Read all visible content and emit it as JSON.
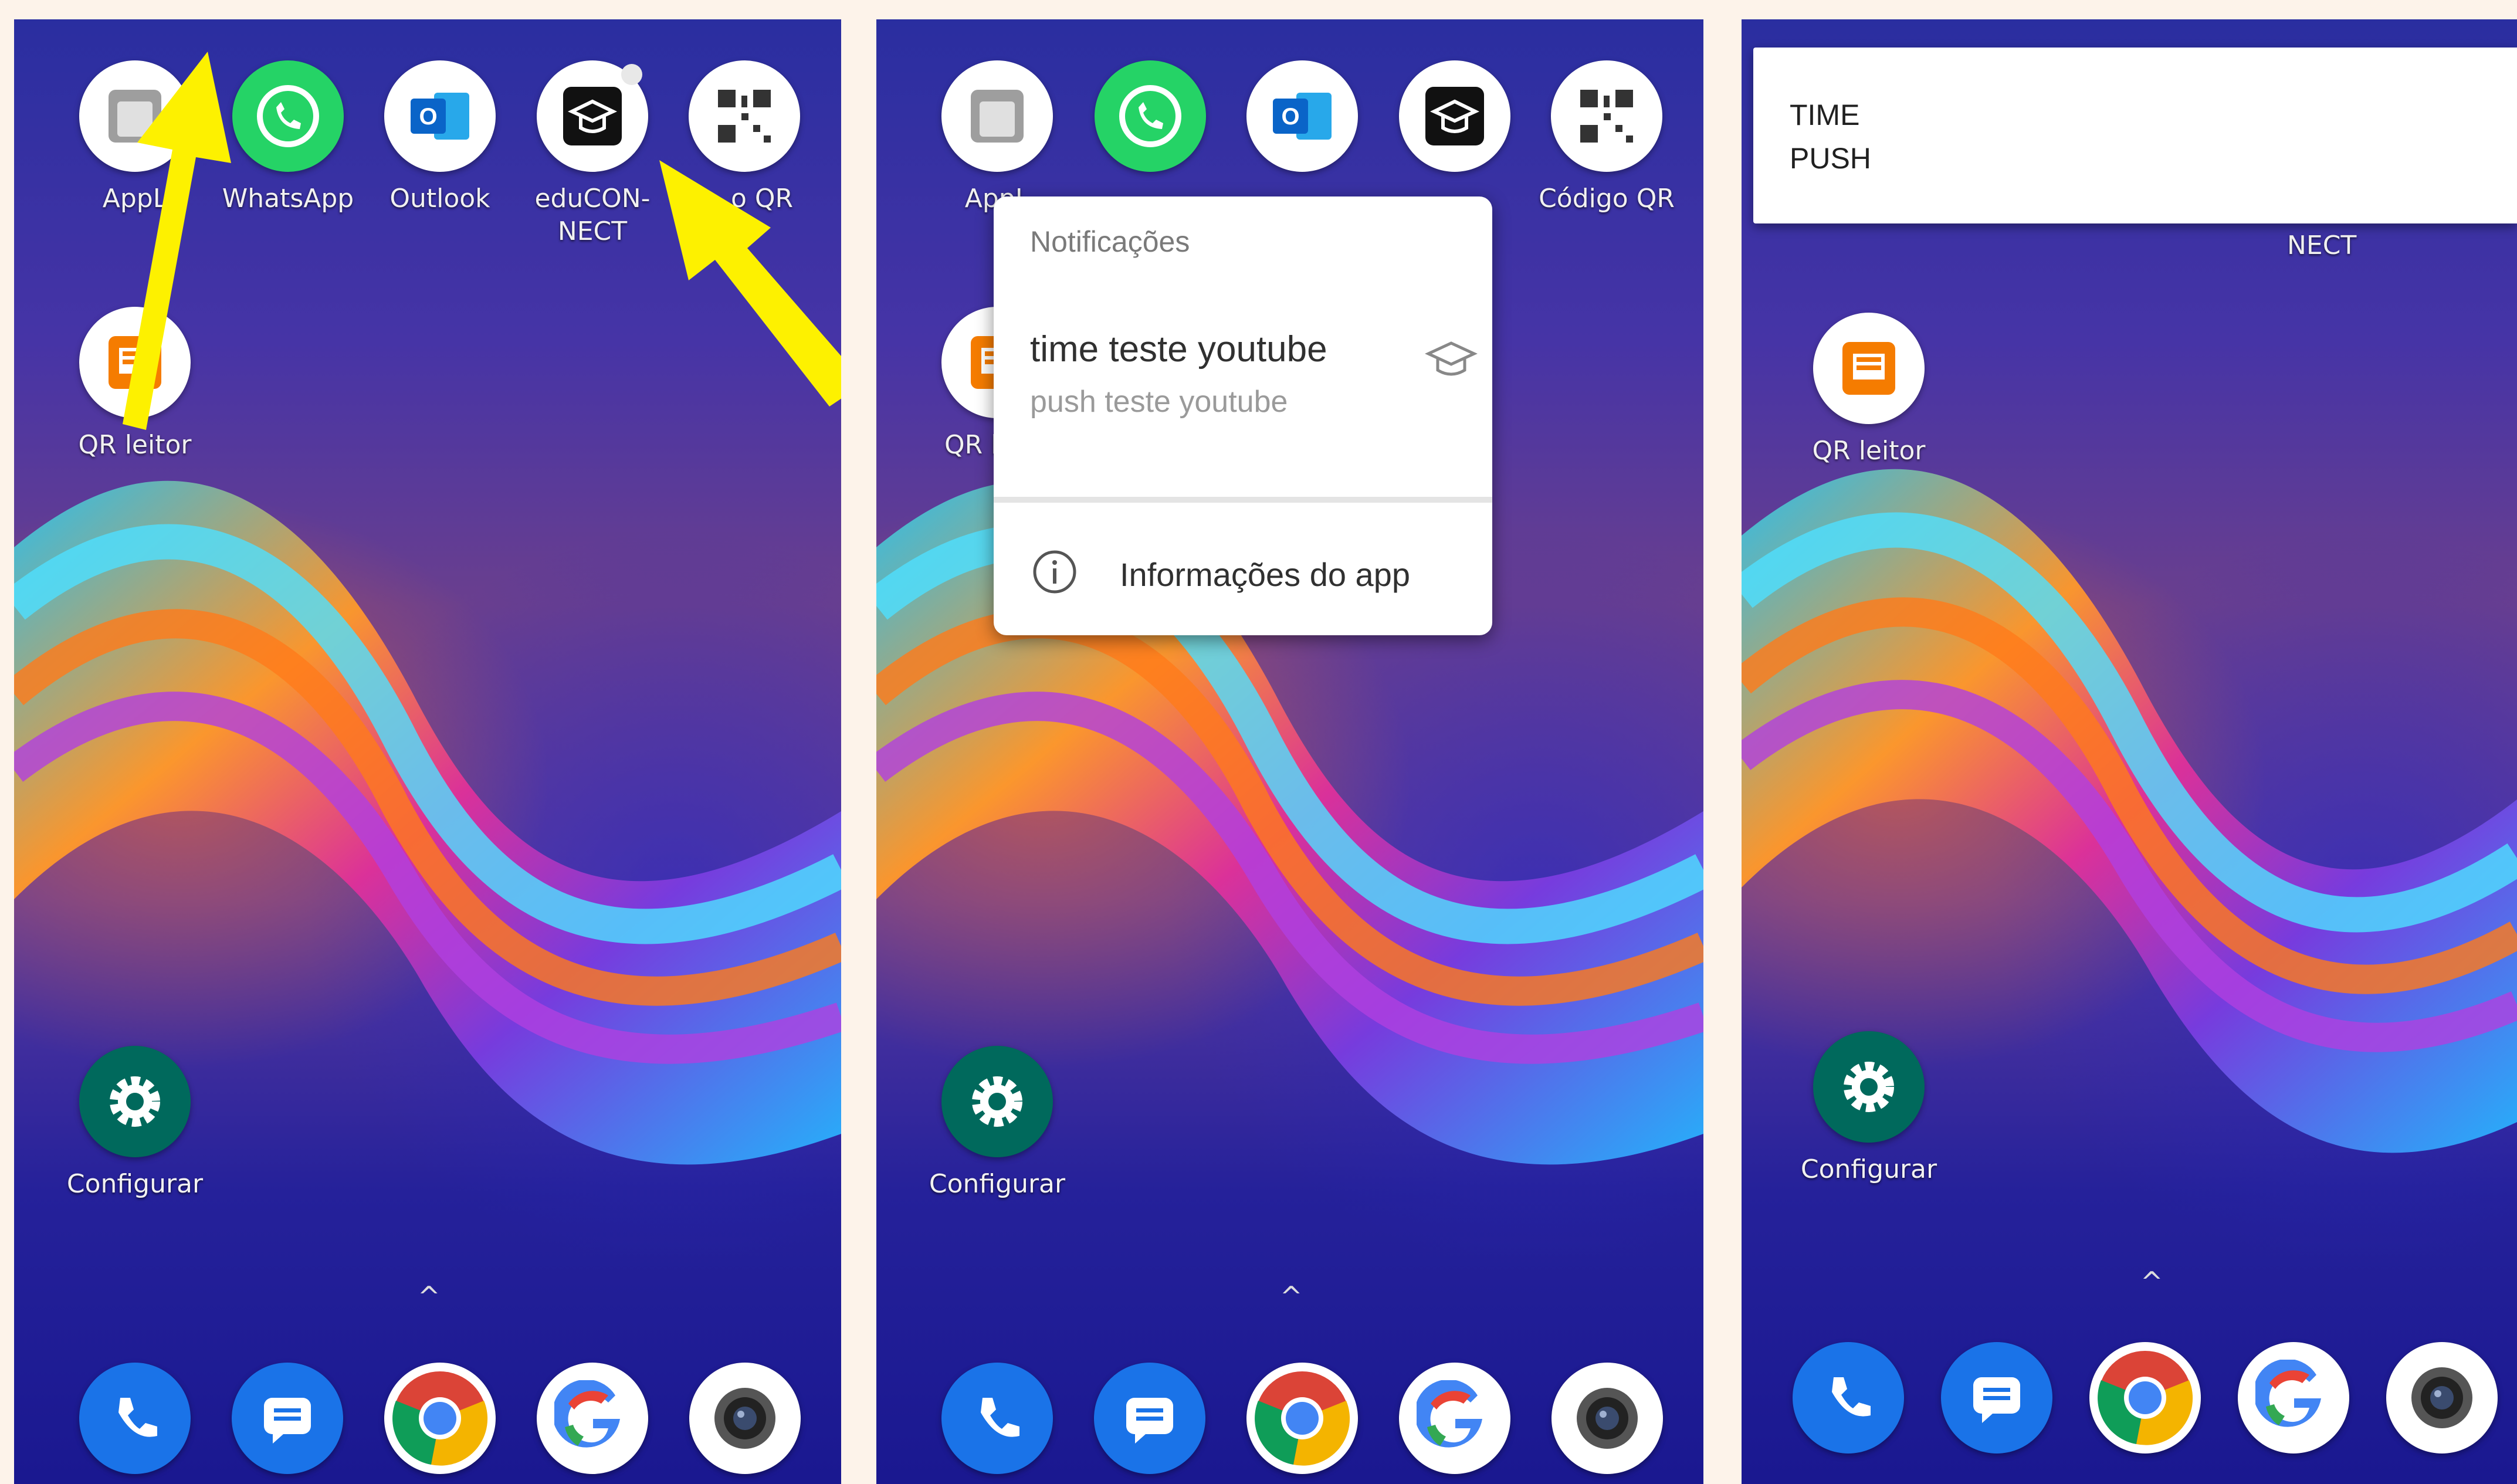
{
  "labels": {
    "applock": "AppL",
    "whatsapp": "WhatsApp",
    "outlook": "Outlook",
    "educonnect": "eduCON-\nNECT",
    "codigo_qr": "Código QR",
    "codigo_qr_partial": "o QR",
    "qr_leitor": "QR leitor",
    "qr_leitor_partial": "QR le",
    "configurar": "Configurar",
    "nect": "NECT",
    "chevron": "^"
  },
  "popup": {
    "header": "Notificações",
    "notification_title": "time teste youtube",
    "notification_text": "push teste youtube",
    "app_info": "Informações do app"
  },
  "toast": {
    "title": "TIME",
    "body": "PUSH"
  },
  "colors": {
    "arrow": "#fdf100",
    "whatsapp": "#25d366",
    "outlook": "#0a64c8",
    "settings": "#00695c",
    "phone": "#1a73e8"
  }
}
